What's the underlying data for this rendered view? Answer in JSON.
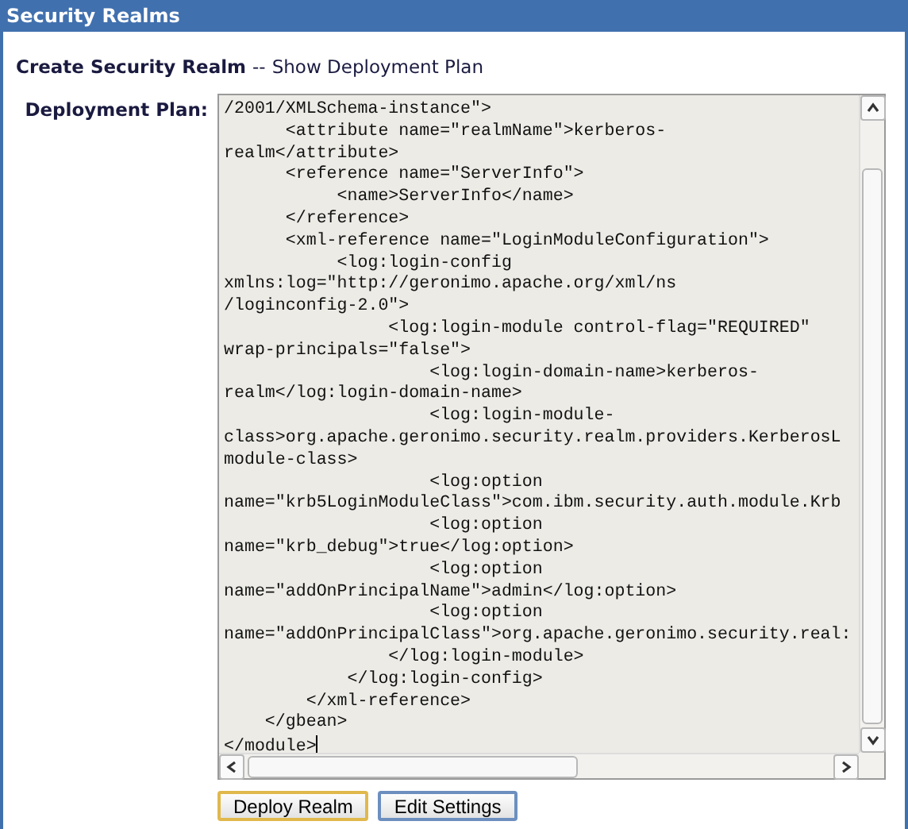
{
  "header": {
    "title": "Security Realms"
  },
  "breadcrumb": {
    "current": "Create Security Realm",
    "separator": "--",
    "link": "Show Deployment Plan"
  },
  "form": {
    "label": "Deployment Plan:",
    "plan_lines": [
      "/2001/XMLSchema-instance\">",
      "      <attribute name=\"realmName\">kerberos-",
      "realm</attribute>",
      "      <reference name=\"ServerInfo\">",
      "           <name>ServerInfo</name>",
      "      </reference>",
      "      <xml-reference name=\"LoginModuleConfiguration\">",
      "           <log:login-config",
      "xmlns:log=\"http://geronimo.apache.org/xml/ns",
      "/loginconfig-2.0\">",
      "                <log:login-module control-flag=\"REQUIRED\"",
      "wrap-principals=\"false\">",
      "                    <log:login-domain-name>kerberos-",
      "realm</log:login-domain-name>",
      "                    <log:login-module-",
      "class>org.apache.geronimo.security.realm.providers.KerberosL",
      "module-class>",
      "                    <log:option",
      "name=\"krb5LoginModuleClass\">com.ibm.security.auth.module.Krb",
      "                    <log:option",
      "name=\"krb_debug\">true</log:option>",
      "                    <log:option",
      "name=\"addOnPrincipalName\">admin</log:option>",
      "                    <log:option",
      "name=\"addOnPrincipalClass\">org.apache.geronimo.security.real:",
      "                </log:login-module>",
      "            </log:login-config>",
      "        </xml-reference>",
      "    </gbean>",
      "</module>"
    ]
  },
  "buttons": [
    {
      "label": "Deploy Realm",
      "focused": true
    },
    {
      "label": "Edit Settings",
      "focused": false
    }
  ]
}
